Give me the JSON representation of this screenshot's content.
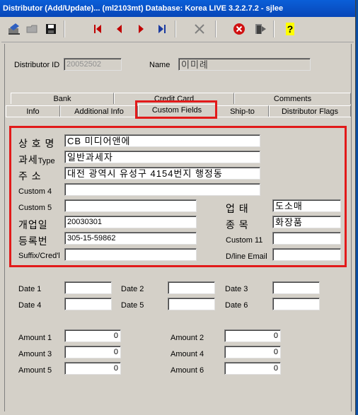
{
  "window": {
    "title": "Distributor (Add/Update)... (ml2103mt)  Database: Korea LIVE 3.2.2.7.2 - sjlee"
  },
  "toolbar": {
    "icons": [
      "edit-icon",
      "folder-icon",
      "save-icon",
      "first-record-icon",
      "prev-record-icon",
      "next-record-icon",
      "last-record-icon",
      "delete-icon",
      "cancel-icon",
      "exit-icon",
      "help-icon"
    ]
  },
  "header": {
    "distributor_id_label": "Distributor ID",
    "distributor_id_value": "20052502",
    "name_label": "Name",
    "name_value": "이미례"
  },
  "tabs": {
    "row1": [
      "Bank",
      "Credit Card",
      "Comments"
    ],
    "row2": [
      "Info",
      "Additional Info",
      "Custom Fields",
      "Ship-to",
      "Distributor Flags"
    ],
    "active": "Custom Fields"
  },
  "custom": {
    "company_name_label": "상 호 명",
    "company_name_value": "CB 미디어앤에",
    "tax_type_label_ko": "과세",
    "tax_type_label_en": "Type",
    "tax_type_value": "일반과세자",
    "address_label": "주 소",
    "address_value": "대전 광역시 유성구 4154번지 행정동",
    "custom4_label": "Custom 4",
    "custom4_value": "",
    "custom5_label": "Custom 5",
    "custom5_value": "",
    "business_type_label": "업 태",
    "business_type_value": "도소매",
    "open_date_label": "개업일",
    "open_date_value": "20030301",
    "category_label": "종 목",
    "category_value": "화장품",
    "reg_no_label": "등록번",
    "reg_no_value": "305-15-59862",
    "custom11_label": "Custom 11",
    "custom11_value": "",
    "suffix_label": "Suffix/Cred'l",
    "suffix_value": "",
    "dline_email_label": "D/line Email",
    "dline_email_value": ""
  },
  "dates": {
    "date1_label": "Date 1",
    "date1_value": "",
    "date2_label": "Date 2",
    "date2_value": "",
    "date3_label": "Date 3",
    "date3_value": "",
    "date4_label": "Date 4",
    "date4_value": "",
    "date5_label": "Date 5",
    "date5_value": "",
    "date6_label": "Date 6",
    "date6_value": ""
  },
  "amounts": {
    "amount1_label": "Amount 1",
    "amount1_value": "0",
    "amount2_label": "Amount 2",
    "amount2_value": "0",
    "amount3_label": "Amount 3",
    "amount3_value": "0",
    "amount4_label": "Amount 4",
    "amount4_value": "0",
    "amount5_label": "Amount 5",
    "amount5_value": "0",
    "amount6_label": "Amount 6",
    "amount6_value": "0"
  },
  "colors": {
    "highlight": "#e21a1a",
    "titlebar": "#0a5fd8",
    "dialog_bg": "#d4d0c8"
  }
}
